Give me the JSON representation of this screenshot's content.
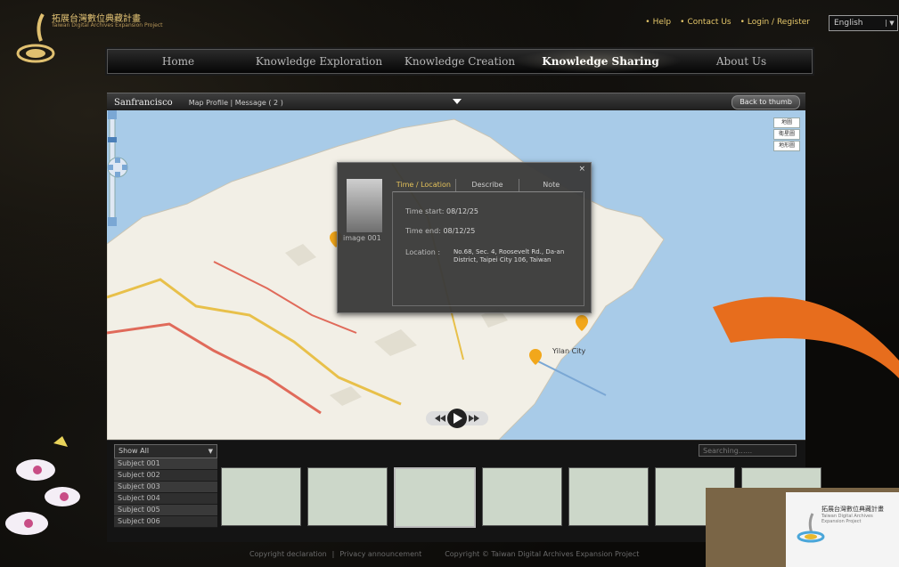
{
  "header": {
    "logo_title": "拓展台灣數位典藏計畫",
    "logo_subtitle": "Taiwan Digital Archives Expansion Project",
    "links": [
      "Help",
      "Contact Us",
      "Login / Register"
    ],
    "language": "English"
  },
  "nav": {
    "items": [
      "Home",
      "Knowledge Exploration",
      "Knowledge Creation",
      "Knowledge Sharing",
      "About Us"
    ],
    "active": "Knowledge Sharing"
  },
  "subbar": {
    "location": "Sanfrancisco",
    "links": "Map Profile | Message ( 2 )",
    "back": "Back to thumb"
  },
  "map": {
    "controls": [
      "地圖",
      "衛星圖",
      "地形圖"
    ],
    "labels": [
      "Yilan City"
    ]
  },
  "popup": {
    "thumb_caption": "image 001",
    "tabs": [
      "Time / Location",
      "Describe",
      "Note"
    ],
    "time_start_label": "Time start:",
    "time_start": "08/12/25",
    "time_end_label": "Time end:",
    "time_end": "08/12/25",
    "location_label": "Location :",
    "location": "No.68, Sec. 4, Roosevelt Rd., Da-an District, Taipei City 106, Taiwan",
    "close": "×"
  },
  "bottom": {
    "filter": "Show All",
    "subjects": [
      "Subject 001",
      "Subject 002",
      "Subject 003",
      "Subject 004",
      "Subject 005",
      "Subject 006"
    ],
    "search_placeholder": "Searching......"
  },
  "footer": {
    "copyright": "Copyright declaration",
    "privacy": "Privacy announcement",
    "owner": "Copyright © Taiwan Digital Archives Expansion Project"
  },
  "card": {
    "title": "拓展台灣數位典藏計畫",
    "subtitle": "Taiwan Digital Archives Expansion Project"
  }
}
